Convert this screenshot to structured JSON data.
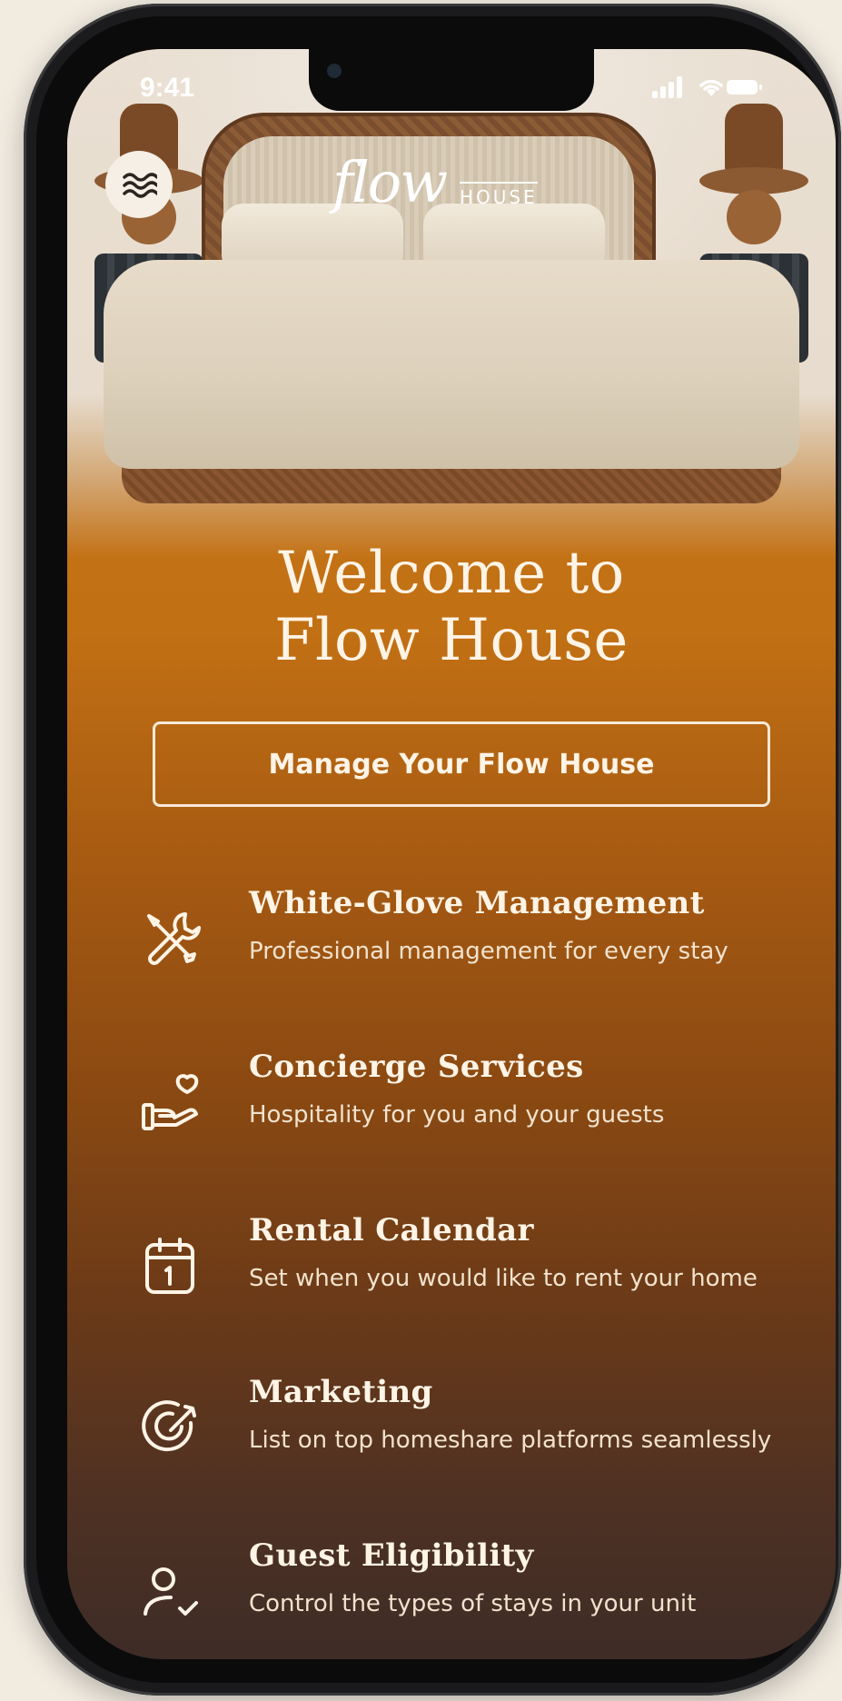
{
  "status_bar": {
    "time": "9:41"
  },
  "logo": {
    "script": "flow",
    "word": "HOUSE"
  },
  "hero": {
    "title_line1": "Welcome to",
    "title_line2": "Flow House"
  },
  "cta": {
    "label": "Manage Your Flow House"
  },
  "features": [
    {
      "icon": "tools-icon",
      "title": "White-Glove Management",
      "desc": "Professional management for every stay"
    },
    {
      "icon": "hand-heart-icon",
      "title": "Concierge Services",
      "desc": "Hospitality for you and your guests"
    },
    {
      "icon": "calendar-icon",
      "title": "Rental Calendar",
      "desc": "Set when you would like to rent your home"
    },
    {
      "icon": "target-icon",
      "title": "Marketing",
      "desc": "List on top homeshare platforms seamlessly"
    },
    {
      "icon": "user-check-icon",
      "title": "Guest Eligibility",
      "desc": "Control the types of stays in your unit"
    }
  ],
  "colors": {
    "accent": "#c27014",
    "text": "#fff4e6",
    "background": "#f1ebe0"
  }
}
